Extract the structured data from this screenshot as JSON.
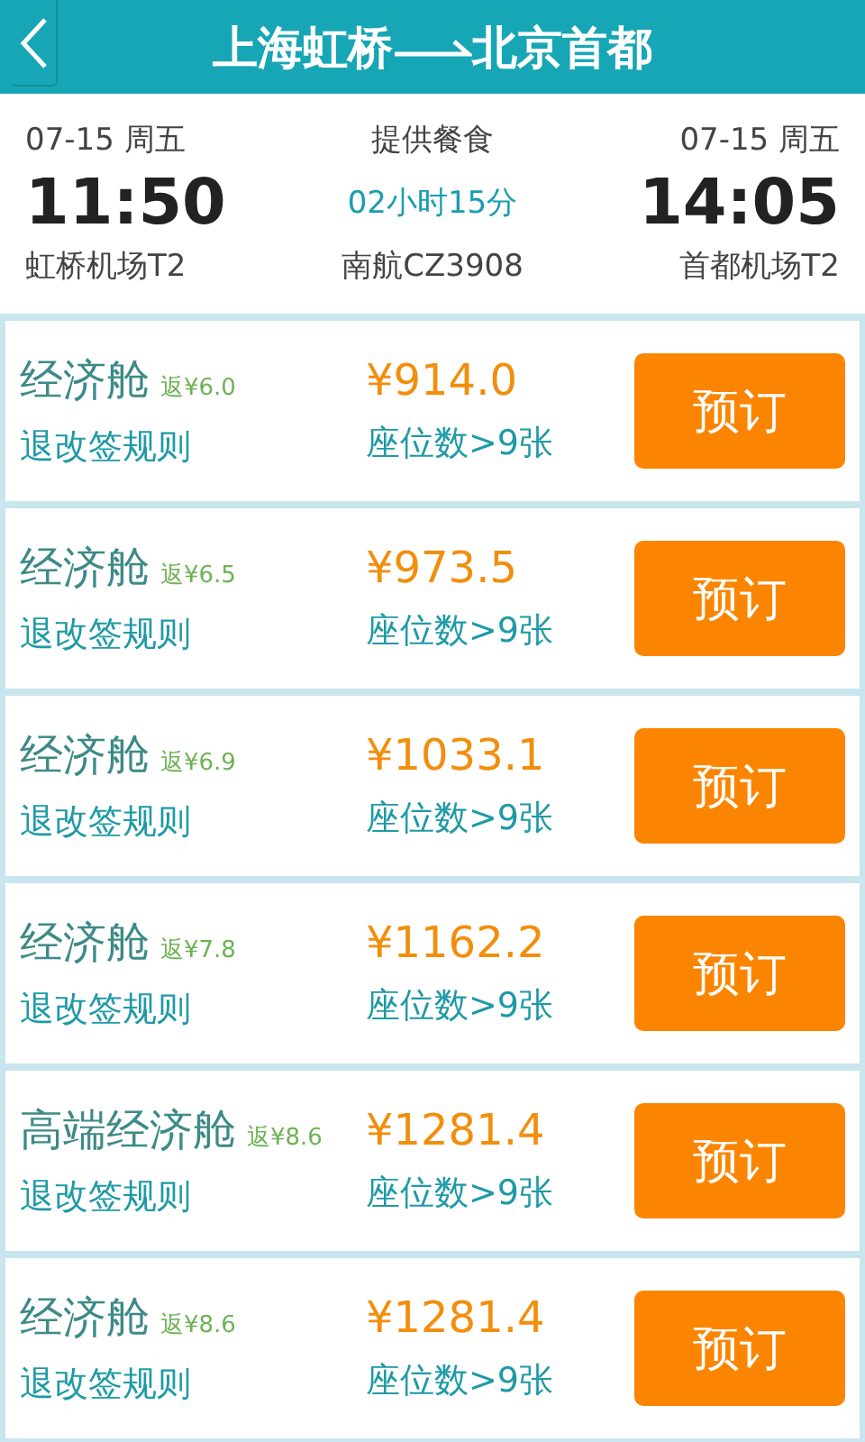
{
  "header": {
    "from": "上海虹桥",
    "to": "北京首都"
  },
  "flight": {
    "depart_date": "07-15 周五",
    "depart_time": "11:50",
    "depart_airport": "虹桥机场T2",
    "meal": "提供餐食",
    "duration": "02小时15分",
    "flight_no": "南航CZ3908",
    "arrive_date": "07-15 周五",
    "arrive_time": "14:05",
    "arrive_airport": "首都机场T2"
  },
  "fares": [
    {
      "cabin": "经济舱",
      "rebate": "返¥6.0",
      "price": "¥914.0",
      "rules": "退改签规则",
      "seats": "座位数>9张",
      "button": "预订"
    },
    {
      "cabin": "经济舱",
      "rebate": "返¥6.5",
      "price": "¥973.5",
      "rules": "退改签规则",
      "seats": "座位数>9张",
      "button": "预订"
    },
    {
      "cabin": "经济舱",
      "rebate": "返¥6.9",
      "price": "¥1033.1",
      "rules": "退改签规则",
      "seats": "座位数>9张",
      "button": "预订"
    },
    {
      "cabin": "经济舱",
      "rebate": "返¥7.8",
      "price": "¥1162.2",
      "rules": "退改签规则",
      "seats": "座位数>9张",
      "button": "预订"
    },
    {
      "cabin": "高端经济舱",
      "rebate": "返¥8.6",
      "price": "¥1281.4",
      "rules": "退改签规则",
      "seats": "座位数>9张",
      "button": "预订"
    },
    {
      "cabin": "经济舱",
      "rebate": "返¥8.6",
      "price": "¥1281.4",
      "rules": "退改签规则",
      "seats": "座位数>9张",
      "button": "预订"
    }
  ]
}
